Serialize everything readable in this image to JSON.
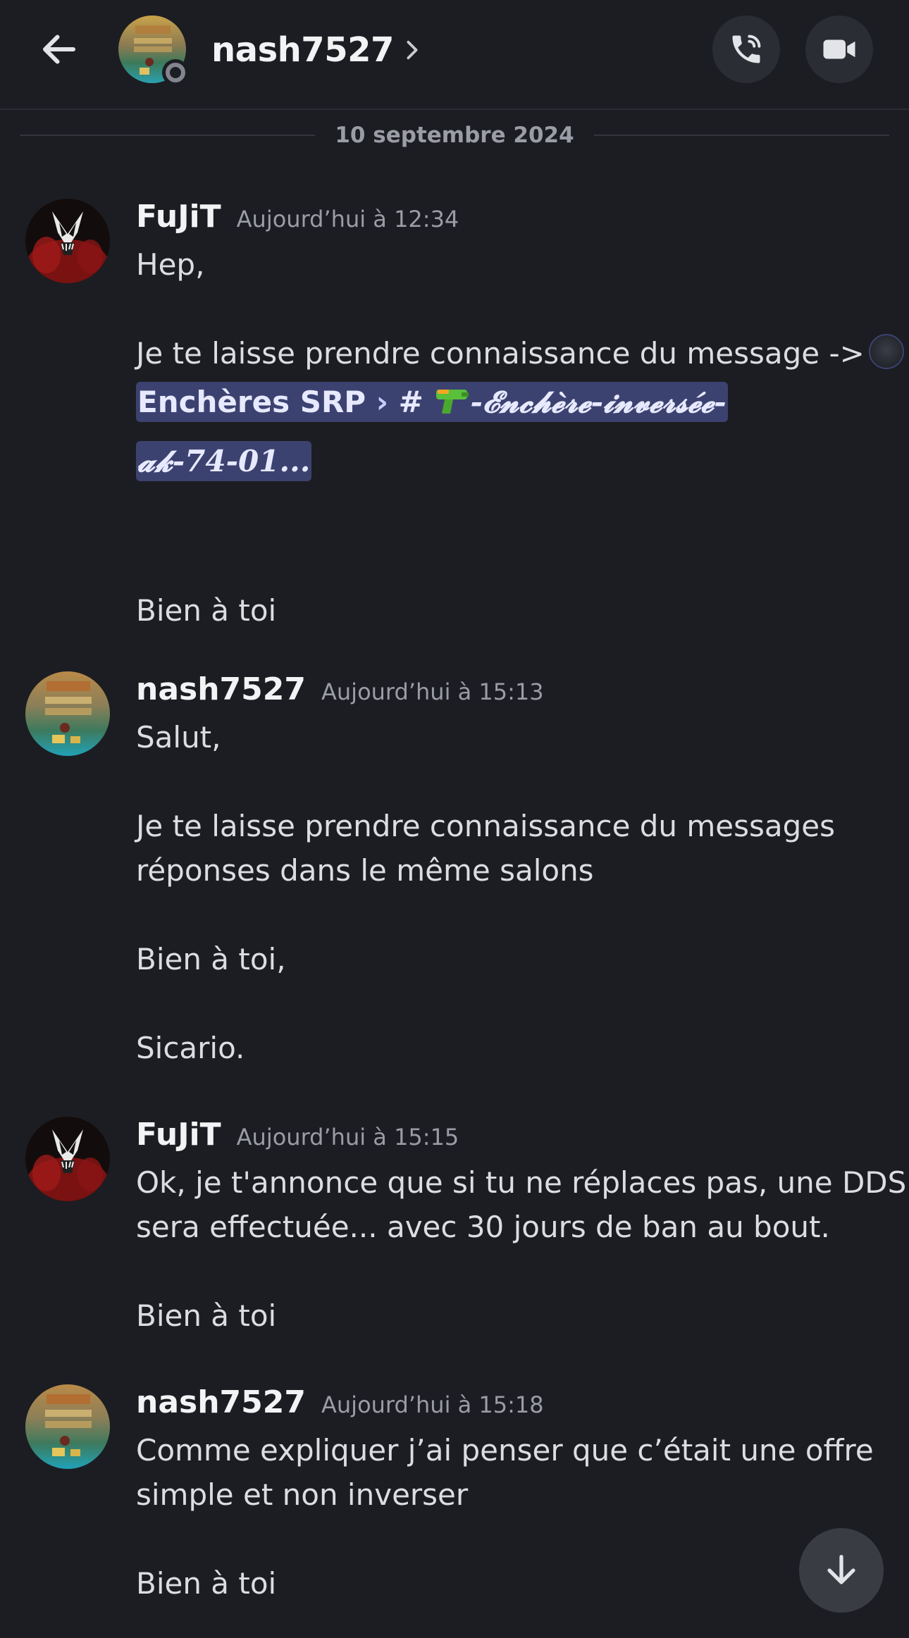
{
  "header": {
    "title": "nash7527",
    "back_icon": "arrow-left-icon",
    "call_icon": "phone-call-icon",
    "video_icon": "video-camera-icon"
  },
  "date_divider": "10 septembre 2024",
  "messages": [
    {
      "author": "FuJiT",
      "timestamp": "Aujourd’hui à 12:34",
      "lines": {
        "l1": "Hep,",
        "l2": "Je te laisse prendre connaissance du message ->",
        "l3": "Bien à toi"
      },
      "mention": {
        "server": "Enchères SRP",
        "hash": "#",
        "channel_a": "-𝓔𝓷𝓬𝓱𝓮̀𝓻𝓮-𝓲𝓷𝓿𝓮𝓻𝓼𝓮́𝓮-",
        "channel_b": "𝓪𝓴-74-01..."
      }
    },
    {
      "author": "nash7527",
      "timestamp": "Aujourd’hui à 15:13",
      "lines": {
        "l1": "Salut,",
        "l2": "Je te laisse prendre connaissance du messages",
        "l3": "réponses dans le même salons",
        "l4": "Bien à toi,",
        "l5": "Sicario."
      }
    },
    {
      "author": "FuJiT",
      "timestamp": "Aujourd’hui à 15:15",
      "lines": {
        "l1": "Ok, je t'annonce que si tu ne réplaces pas, une DDS",
        "l2": "sera effectuée... avec 30 jours de ban au bout.",
        "l3": "Bien à toi"
      }
    },
    {
      "author": "nash7527",
      "timestamp": "Aujourd’hui à 15:18",
      "lines": {
        "l1": "Comme expliquer j’ai penser que c’était une offre",
        "l2": "simple et non inverser",
        "l3": "Bien à toi"
      }
    }
  ],
  "colors": {
    "background": "#1c1d22",
    "mention_bg": "#3c4270",
    "text": "#dcdde2",
    "muted": "#9a9ca6"
  }
}
